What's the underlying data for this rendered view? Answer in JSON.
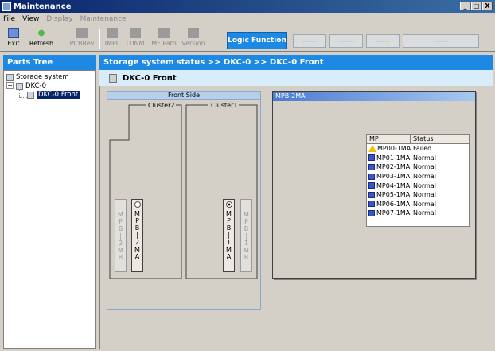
{
  "window": {
    "title": "Maintenance",
    "controls": [
      "_",
      "□",
      "X"
    ]
  },
  "menu": [
    {
      "label": "File",
      "disabled": false
    },
    {
      "label": "View",
      "disabled": false
    },
    {
      "label": "Display",
      "disabled": true
    },
    {
      "label": "Maintenance",
      "disabled": true
    }
  ],
  "toolbar": {
    "exit": "Exit",
    "refresh": "Refresh",
    "pcbrev": "PCBRev",
    "impl": "IMPL",
    "luinm": "LUNM",
    "mfpath": "MF Path",
    "version": "Version",
    "logic_function": "Logic Function",
    "dash_buttons": [
      "------",
      "------",
      "------",
      "------"
    ]
  },
  "tree": {
    "header": "Parts Tree",
    "nodes": [
      "Storage system",
      "DKC-0",
      "DKC-0 Front"
    ]
  },
  "content": {
    "path": "Storage system status >> DKC-0 >> DKC-0 Front",
    "subtitle": "DKC-0 Front",
    "front_side_title": "Front Side",
    "cluster2": "Cluster2",
    "cluster1": "Cluster1",
    "slots": {
      "mpb_2mb": "MPB-2MB",
      "mpb_2ma": "MPB-2MA",
      "mpb_1ma": "MPB-1MA",
      "mpb_1mb": "MPB-1MB"
    }
  },
  "mpb_window": {
    "title": "MPB-2MA",
    "columns": [
      "MP",
      "Status"
    ],
    "rows": [
      {
        "mp": "MP00-1MA",
        "status": "Failed",
        "icon": "warning-icon"
      },
      {
        "mp": "MP01-1MA",
        "status": "Normal",
        "icon": "chip-icon"
      },
      {
        "mp": "MP02-1MA",
        "status": "Normal",
        "icon": "chip-icon"
      },
      {
        "mp": "MP03-1MA",
        "status": "Normal",
        "icon": "chip-icon"
      },
      {
        "mp": "MP04-1MA",
        "status": "Normal",
        "icon": "chip-icon"
      },
      {
        "mp": "MP05-1MA",
        "status": "Normal",
        "icon": "chip-icon"
      },
      {
        "mp": "MP06-1MA",
        "status": "Normal",
        "icon": "chip-icon"
      },
      {
        "mp": "MP07-1MA",
        "status": "Normal",
        "icon": "chip-icon"
      }
    ]
  },
  "colors": {
    "accent": "#1e88e5",
    "selected": "#0a246a",
    "subheader": "#d8ecfa"
  }
}
